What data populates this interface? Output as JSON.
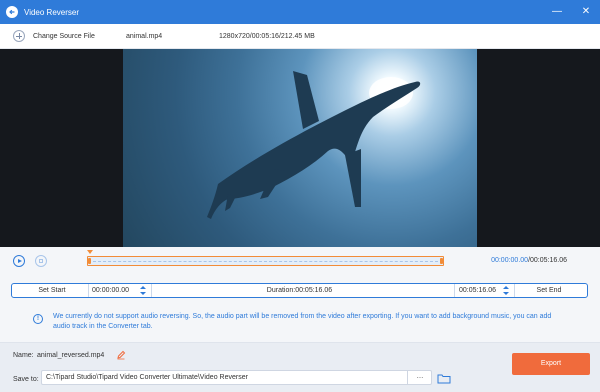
{
  "window": {
    "title": "Video Reverser",
    "app_icon": "reverse-arrow-icon",
    "minimize": "—",
    "close": "✕"
  },
  "source": {
    "change_label": "Change Source File",
    "file_name": "animal.mp4",
    "file_info": "1280x720/00:05:16/212.45 MB"
  },
  "playback": {
    "current_time": "00:00:00.00",
    "separator": "/",
    "total_time": "00:05:16.06"
  },
  "trim": {
    "set_start_label": "Set Start",
    "start_time": "00:00:00.00",
    "duration": "Duration:00:05:16.06",
    "end_time": "00:05:16.06",
    "set_end_label": "Set End"
  },
  "notice": {
    "icon": "info-icon",
    "glyph": "!",
    "text": "We currently do not support audio reversing. So, the audio part will be removed from the video after exporting. If you want to add background music, you can add audio track in the Converter tab."
  },
  "output": {
    "name_label": "Name:",
    "name_value": "animal_reversed.mp4",
    "save_label": "Save to:",
    "save_path": "C:\\Tipard Studio\\Tipard Video Converter Ultimate\\Video Reverser",
    "browse_label": "...",
    "export_label": "Export"
  },
  "colors": {
    "accent": "#2f7bd9",
    "export": "#f06b3c",
    "trim_handle": "#f28c38"
  }
}
